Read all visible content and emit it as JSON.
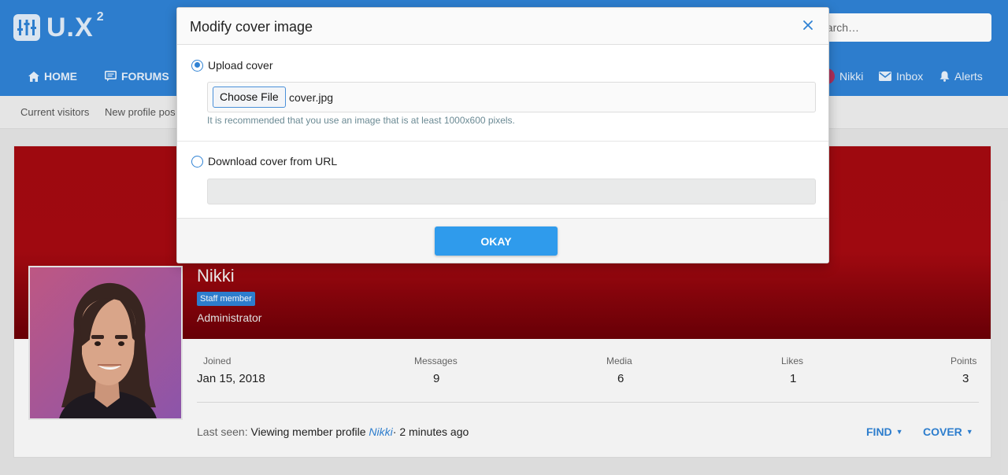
{
  "header": {
    "logo_text": "U.X",
    "logo_sup": "2",
    "search_placeholder": "earch…",
    "nav": [
      {
        "label": "HOME",
        "icon": "home-icon"
      },
      {
        "label": "FORUMS",
        "icon": "forums-icon"
      }
    ],
    "user": {
      "name": "Nikki",
      "inbox": "Inbox",
      "alerts": "Alerts"
    }
  },
  "subnav": {
    "items": [
      "Current visitors",
      "New profile pos"
    ]
  },
  "profile": {
    "name": "Nikki",
    "badge": "Staff member",
    "role": "Administrator",
    "stats": [
      {
        "label": "Joined",
        "value": "Jan 15, 2018"
      },
      {
        "label": "Messages",
        "value": "9"
      },
      {
        "label": "Media",
        "value": "6"
      },
      {
        "label": "Likes",
        "value": "1"
      },
      {
        "label": "Points",
        "value": "3"
      }
    ],
    "last_seen": {
      "prefix": "Last seen:",
      "activity": "Viewing member profile",
      "link": "Nikki",
      "time": "· 2 minutes ago"
    },
    "actions": {
      "find": "FIND",
      "cover": "COVER"
    }
  },
  "modal": {
    "title": "Modify cover image",
    "upload_label": "Upload cover",
    "choose_file_label": "Choose File",
    "file_name": "cover.jpg",
    "hint": "It is recommended that you use an image that is at least 1000x600 pixels.",
    "url_label": "Download cover from URL",
    "url_value": "",
    "okay_label": "OKAY"
  },
  "colors": {
    "accent": "#2f82d4",
    "cover": "#a40a10",
    "button": "#2f9bec"
  }
}
